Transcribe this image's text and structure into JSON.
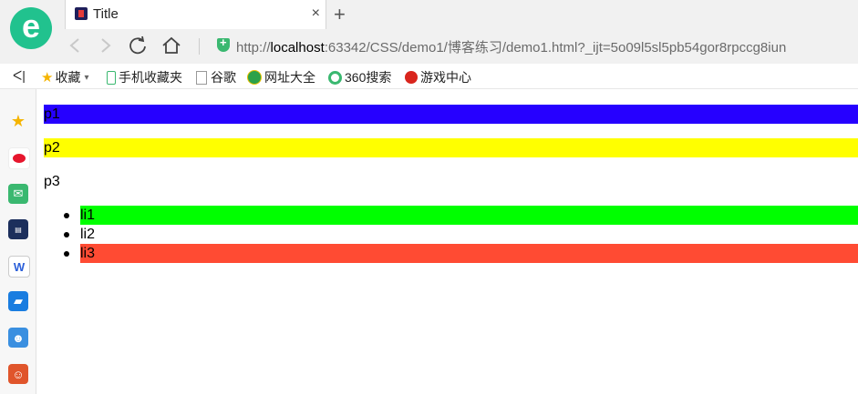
{
  "browser": {
    "logo_letter": "e",
    "tab_title": "Title",
    "tab_close": "×",
    "new_tab": "+",
    "url_prefix": "http://",
    "url_host": "localhost",
    "url_rest": ":63342/CSS/demo1/博客练习/demo1.html?_ijt=5o09l5sl5pb54gor8rpccg8iun"
  },
  "bookmarks": {
    "toggle": "ᐸ|",
    "items": [
      {
        "label": "收藏",
        "icon": "star-icon",
        "color": "#f5b400"
      },
      {
        "label": "手机收藏夹",
        "icon": "phone-icon",
        "color": "#3ab870"
      },
      {
        "label": "谷歌",
        "icon": "page-icon",
        "color": "#999999"
      },
      {
        "label": "网址大全",
        "icon": "globe-icon",
        "color": "#2da14a"
      },
      {
        "label": "360搜索",
        "icon": "search-360-icon",
        "color": "#3ab870"
      },
      {
        "label": "游戏中心",
        "icon": "game-icon",
        "color": "#d9251d"
      }
    ]
  },
  "page": {
    "p1": "p1",
    "p2": "p2",
    "p3": "p3",
    "li1": "li1",
    "li2": "li2",
    "li3": "li3",
    "colors": {
      "p1_bg": "#2600ff",
      "p2_bg": "#ffff00",
      "li1_bg": "#00ff00",
      "li3_bg": "#ff4b33"
    }
  }
}
